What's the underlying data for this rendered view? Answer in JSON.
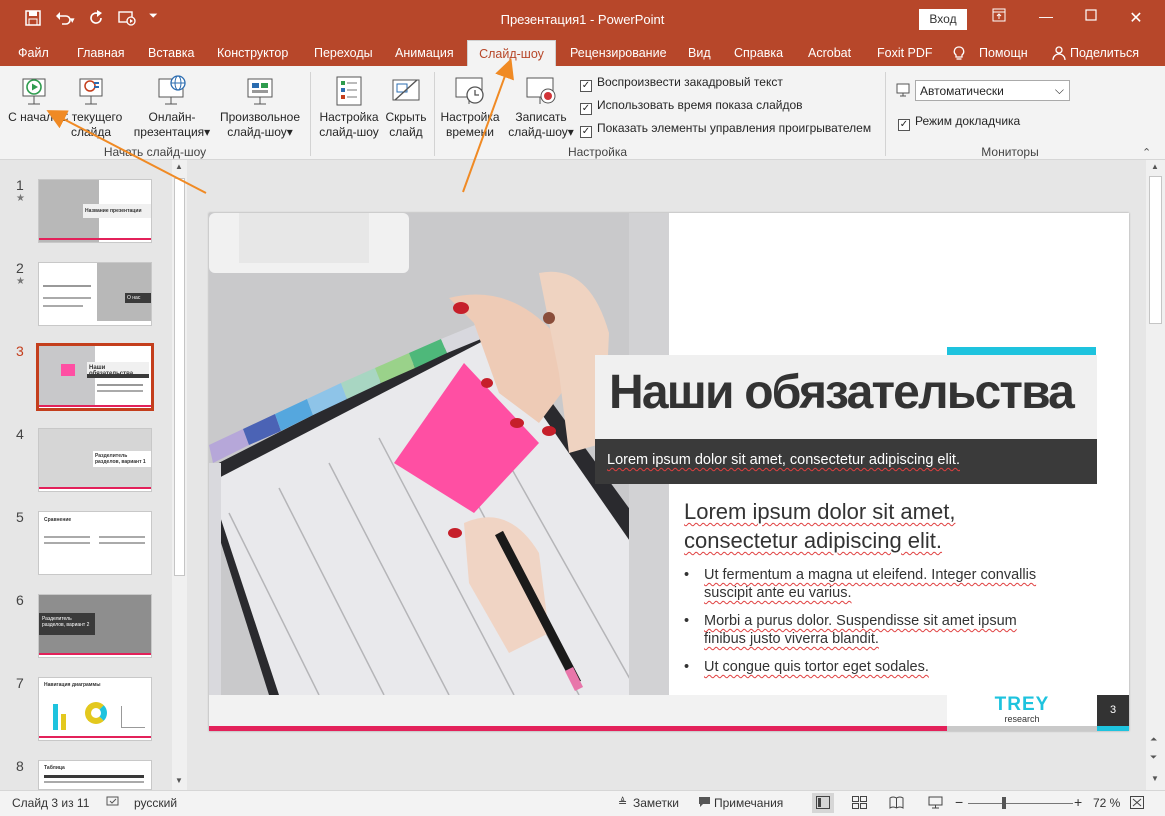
{
  "window": {
    "title": "Презентация1  -  PowerPoint",
    "login_label": "Вход"
  },
  "qat": {
    "save": "save-icon",
    "undo": "undo-icon",
    "redo": "redo-icon",
    "present": "present-icon",
    "customize": "customize-icon"
  },
  "tabs": [
    "Файл",
    "Главная",
    "Вставка",
    "Конструктор",
    "Переходы",
    "Анимация",
    "Слайд-шоу",
    "Рецензирование",
    "Вид",
    "Справка",
    "Acrobat",
    "Foxit PDF",
    "Помощн",
    "Поделиться"
  ],
  "active_tab": "Слайд-шоу",
  "ribbon": {
    "start_group": {
      "label": "Начать слайд-шоу",
      "from_start": "С начала",
      "from_current": "С текущего слайда",
      "online": "Онлайн-презентация",
      "custom": "Произвольное слайд-шоу"
    },
    "setup_group": {
      "label": "Настройка",
      "setup": "Настройка слайд-шоу",
      "hide": "Скрыть слайд",
      "rehearse": "Настройка времени",
      "record": "Записать слайд-шоу",
      "checkboxes": [
        {
          "label": "Воспроизвести закадровый текст",
          "checked": true
        },
        {
          "label": "Использовать время показа слайдов",
          "checked": true
        },
        {
          "label": "Показать элементы управления проигрывателем",
          "checked": true
        }
      ]
    },
    "monitors_group": {
      "label": "Мониторы",
      "monitor_value": "Автоматически",
      "presenter_view": "Режим докладчика",
      "presenter_checked": true
    }
  },
  "thumbnails": [
    {
      "num": "1",
      "star": "★",
      "caption": "Название презентации"
    },
    {
      "num": "2",
      "star": "★",
      "caption": "О нас"
    },
    {
      "num": "3",
      "caption": "Наши обязательства"
    },
    {
      "num": "4",
      "caption": "Разделитель разделов, вариант 1"
    },
    {
      "num": "5",
      "caption": "Сравнение"
    },
    {
      "num": "6",
      "caption": "Разделитель разделов, вариант 2"
    },
    {
      "num": "7",
      "caption": "Навигация диаграммы"
    },
    {
      "num": "8",
      "caption": "Таблица"
    }
  ],
  "slide": {
    "title": "Наши обязательства",
    "subtitle": "Lorem ipsum dolor sit amet, consectetur adipiscing elit.",
    "heading_1": "Lorem ipsum dolor sit amet,",
    "heading_2": "consectetur adipiscing elit.",
    "bullets": [
      [
        "Ut fermentum a magna ut eleifend. Integer convallis",
        "suscipit ante eu varius."
      ],
      [
        "Morbi a purus dolor. Suspendisse sit amet ipsum",
        "finibus justo viverra blandit."
      ],
      [
        "Ut congue quis tortor eget sodales."
      ]
    ],
    "logo_1": "TREY",
    "logo_2": "research",
    "page_number": "3"
  },
  "status": {
    "slide_of": "Слайд 3 из 11",
    "language": "русский",
    "notes": "Заметки",
    "comments": "Примечания",
    "zoom": "72 %"
  },
  "colors": {
    "accent": "#b7472a",
    "cyan": "#1ec3de",
    "magenta": "#e3215a",
    "arrow": "#f08a24"
  }
}
